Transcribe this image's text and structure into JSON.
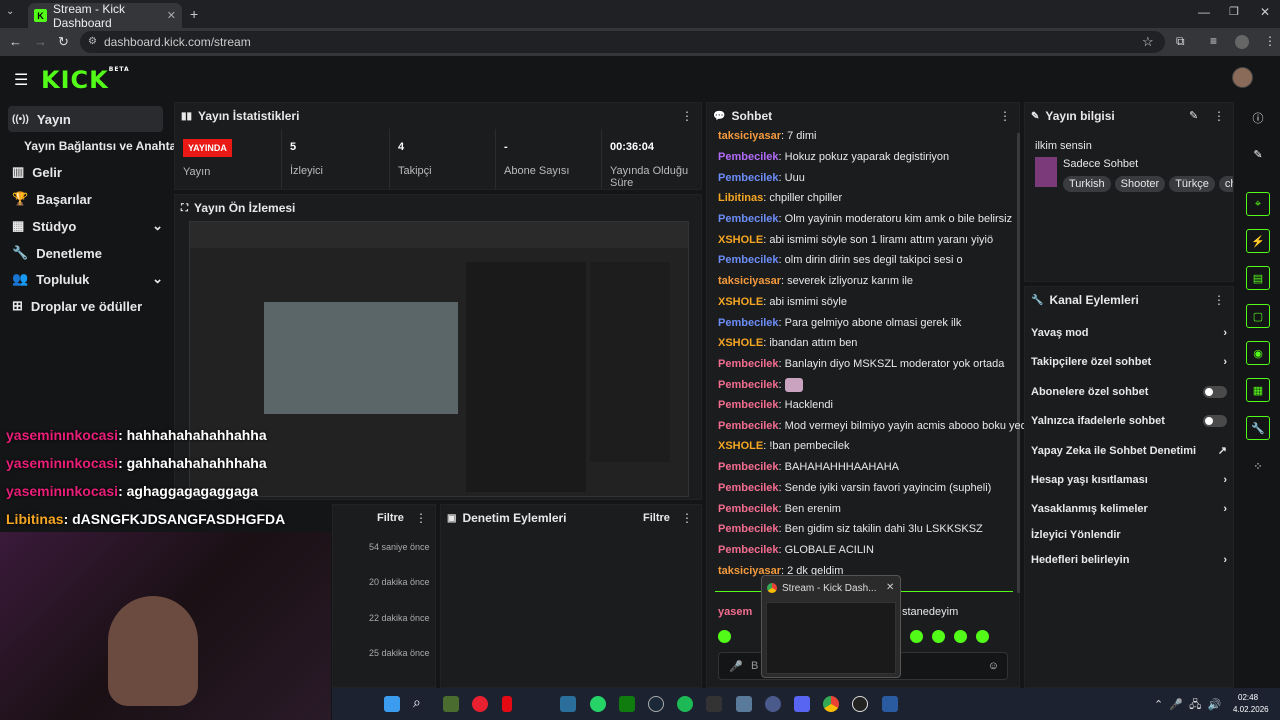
{
  "browser": {
    "tab_title": "Stream - Kick Dashboard",
    "url": "dashboard.kick.com/stream"
  },
  "header": {
    "logo": "KICK",
    "logo_badge": "BETA"
  },
  "sidebar": {
    "items": [
      {
        "label": "Yayın",
        "icon": "broadcast-icon"
      },
      {
        "label": "Yayın Bağlantısı ve Anahtarı",
        "icon": ""
      },
      {
        "label": "Gelir",
        "icon": "chart-icon"
      },
      {
        "label": "Başarılar",
        "icon": "trophy-icon"
      },
      {
        "label": "Stüdyo",
        "icon": "studio-icon"
      },
      {
        "label": "Denetleme",
        "icon": "wrench-icon"
      },
      {
        "label": "Topluluk",
        "icon": "users-icon"
      },
      {
        "label": "Droplar ve ödüller",
        "icon": "gift-icon"
      }
    ]
  },
  "stats": {
    "title": "Yayın İstatistikleri",
    "live_badge": "YAYINDA",
    "live_label": "Yayın",
    "items": [
      {
        "value": "5",
        "label": "İzleyici"
      },
      {
        "value": "4",
        "label": "Takipçi"
      },
      {
        "value": "-",
        "label": "Abone Sayısı"
      },
      {
        "value": "00:36:04",
        "label": "Yayında Olduğu Süre"
      }
    ]
  },
  "preview": {
    "title": "Yayın Ön İzlemesi"
  },
  "activity": {
    "filter": "Filtre",
    "times": [
      "54 saniye önce",
      "20 dakika önce",
      "22 dakika önce",
      "25 dakika önce"
    ]
  },
  "moderation": {
    "title": "Denetim Eylemleri",
    "filter": "Filtre"
  },
  "chat": {
    "title": "Sohbet",
    "messages": [
      {
        "user": "taksiciyasar",
        "color": "#f59b3d",
        "text": "7 dimi"
      },
      {
        "user": "Pembecilek",
        "color": "#b06cf7",
        "text": "Hokuz pokuz yaparak degistiriyon"
      },
      {
        "user": "Pembecilek",
        "color": "#6c8cf7",
        "text": "Uuu"
      },
      {
        "user": "Libitinas",
        "color": "#f5a623",
        "text": "chpiller chpiller"
      },
      {
        "user": "Pembecilek",
        "color": "#6c8cf7",
        "text": "Olm yayinin moderatoru kim amk o bile belirsiz"
      },
      {
        "user": "XSHOLE",
        "color": "#f5a623",
        "text": "abi ismimi söyle son 1 liramı attım yaranı yiyiö"
      },
      {
        "user": "Pembecilek",
        "color": "#6c8cf7",
        "text": "olm dirin dirin ses degil takipci sesi o"
      },
      {
        "user": "taksiciyasar",
        "color": "#f59b3d",
        "text": "severek izliyoruz karım ile"
      },
      {
        "user": "XSHOLE",
        "color": "#f5a623",
        "text": "abi ismimi söyle"
      },
      {
        "user": "Pembecilek",
        "color": "#6c8cf7",
        "text": "Para gelmiyo abone olmasi gerek ilk"
      },
      {
        "user": "XSHOLE",
        "color": "#f5a623",
        "text": "ibandan attım ben"
      },
      {
        "user": "Pembecilek",
        "color": "#f26d8f",
        "text": "Banlayin diyo MSKSZL moderator yok ortada"
      },
      {
        "user": "Pembecilek",
        "color": "#f26d8f",
        "text": ""
      },
      {
        "user": "Pembecilek",
        "color": "#f26d8f",
        "text": "Hacklendi"
      },
      {
        "user": "Pembecilek",
        "color": "#f26d8f",
        "text": "Mod vermeyi bilmiyo yayin acmis abooo boku yedik"
      },
      {
        "user": "XSHOLE",
        "color": "#f5a623",
        "text": "!ban pembecilek"
      },
      {
        "user": "Pembecilek",
        "color": "#f26d8f",
        "text": "BAHAHAHHHAAHAHA"
      },
      {
        "user": "Pembecilek",
        "color": "#f26d8f",
        "text": "Sende iyiki varsin favori yayincim (supheli)"
      },
      {
        "user": "Pembecilek",
        "color": "#f26d8f",
        "text": "Ben erenim"
      },
      {
        "user": "Pembecilek",
        "color": "#f26d8f",
        "text": "Ben gidim siz takilin dahi 3lu LSKKSKSZ"
      },
      {
        "user": "Pembecilek",
        "color": "#f26d8f",
        "text": "GLOBALE ACILIN"
      },
      {
        "user": "taksiciyasar",
        "color": "#f59b3d",
        "text": "2 dk geldim"
      }
    ],
    "partial_user": "yasem",
    "partial_text": "stanedeyim",
    "input_prefix": "B"
  },
  "streaminfo": {
    "title": "Yayın bilgisi",
    "stream_title": "ilkim sensin",
    "category": "Sadece Sohbet",
    "tags": [
      "Turkish",
      "Shooter",
      "Türkçe",
      "ch"
    ]
  },
  "actions": {
    "title": "Kanal Eylemleri",
    "items": [
      {
        "label": "Yavaş mod",
        "control": "chevron"
      },
      {
        "label": "Takipçilere özel sohbet",
        "control": "chevron"
      },
      {
        "label": "Abonelere özel sohbet",
        "control": "toggle"
      },
      {
        "label": "Yalnızca ifadelerle sohbet",
        "control": "toggle"
      },
      {
        "label": "Yapay Zeka ile Sohbet Denetimi",
        "control": "external"
      },
      {
        "label": "Hesap yaşı kısıtlaması",
        "control": "chevron"
      },
      {
        "label": "Yasaklanmış kelimeler",
        "control": "chevron"
      },
      {
        "label": "İzleyici Yönlendir",
        "control": "none"
      },
      {
        "label": "Hedefleri belirleyin",
        "control": "chevron"
      }
    ]
  },
  "overlay": {
    "lines": [
      {
        "user": "yaseminınkocasi",
        "text": ": hahhahahahahhahha"
      },
      {
        "user": "yaseminınkocasi",
        "text": ": gahhahahahahhhaha"
      },
      {
        "user": "yaseminınkocasi",
        "text": ": aghaggagagaggaga"
      },
      {
        "user": "Libitinas",
        "text": ": dASNGFKJDSANGFASDHGFDA"
      }
    ]
  },
  "thumbnail": {
    "title": "Stream - Kick Dash..."
  },
  "taskbar": {
    "time": "02:48",
    "date": "4.02.2026"
  },
  "colors": {
    "accent": "#53fc18",
    "live": "#e91916"
  }
}
